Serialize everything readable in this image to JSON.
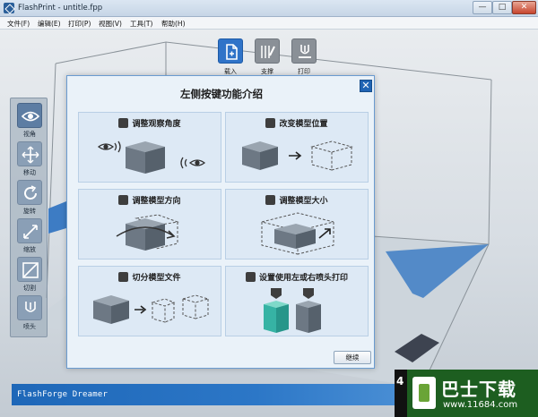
{
  "window": {
    "title": "FlashPrint - untitle.fpp",
    "minimize": "—",
    "maximize": "□",
    "close": "✕"
  },
  "menu": [
    {
      "label": "文件(F)"
    },
    {
      "label": "编辑(E)"
    },
    {
      "label": "打印(P)"
    },
    {
      "label": "视图(V)"
    },
    {
      "label": "工具(T)"
    },
    {
      "label": "帮助(H)"
    }
  ],
  "toolbar": [
    {
      "label": "载入",
      "icon": "load-icon",
      "state": "active"
    },
    {
      "label": "支撑",
      "icon": "support-icon",
      "state": "inactive"
    },
    {
      "label": "打印",
      "icon": "print-icon",
      "state": "inactive"
    }
  ],
  "left_toolbar": [
    {
      "label": "视角",
      "icon": "eye-icon"
    },
    {
      "label": "移动",
      "icon": "move-icon"
    },
    {
      "label": "旋转",
      "icon": "rotate-icon"
    },
    {
      "label": "缩放",
      "icon": "scale-icon"
    },
    {
      "label": "切割",
      "icon": "cut-icon"
    },
    {
      "label": "喷头",
      "icon": "nozzle-icon"
    }
  ],
  "dialog": {
    "title": "左侧按键功能介绍",
    "close": "✕",
    "cards": [
      {
        "title": "调整观察角度",
        "icon": "eye-icon"
      },
      {
        "title": "改变模型位置",
        "icon": "move-icon"
      },
      {
        "title": "调整模型方向",
        "icon": "rotate-icon"
      },
      {
        "title": "调整模型大小",
        "icon": "scale-icon"
      },
      {
        "title": "切分模型文件",
        "icon": "cut-icon"
      },
      {
        "title": "设置使用左或右喷头打印",
        "icon": "nozzle-icon"
      }
    ],
    "continue_label": "继续"
  },
  "status": {
    "text": "FlashForge Dreamer"
  },
  "watermark": {
    "badge": "4",
    "title": "巴士下载",
    "url": "www.11684.com"
  },
  "colors": {
    "accent": "#2f73c8",
    "status_bar": "#1e67b8",
    "dialog_bg": "#eaf2f9"
  }
}
